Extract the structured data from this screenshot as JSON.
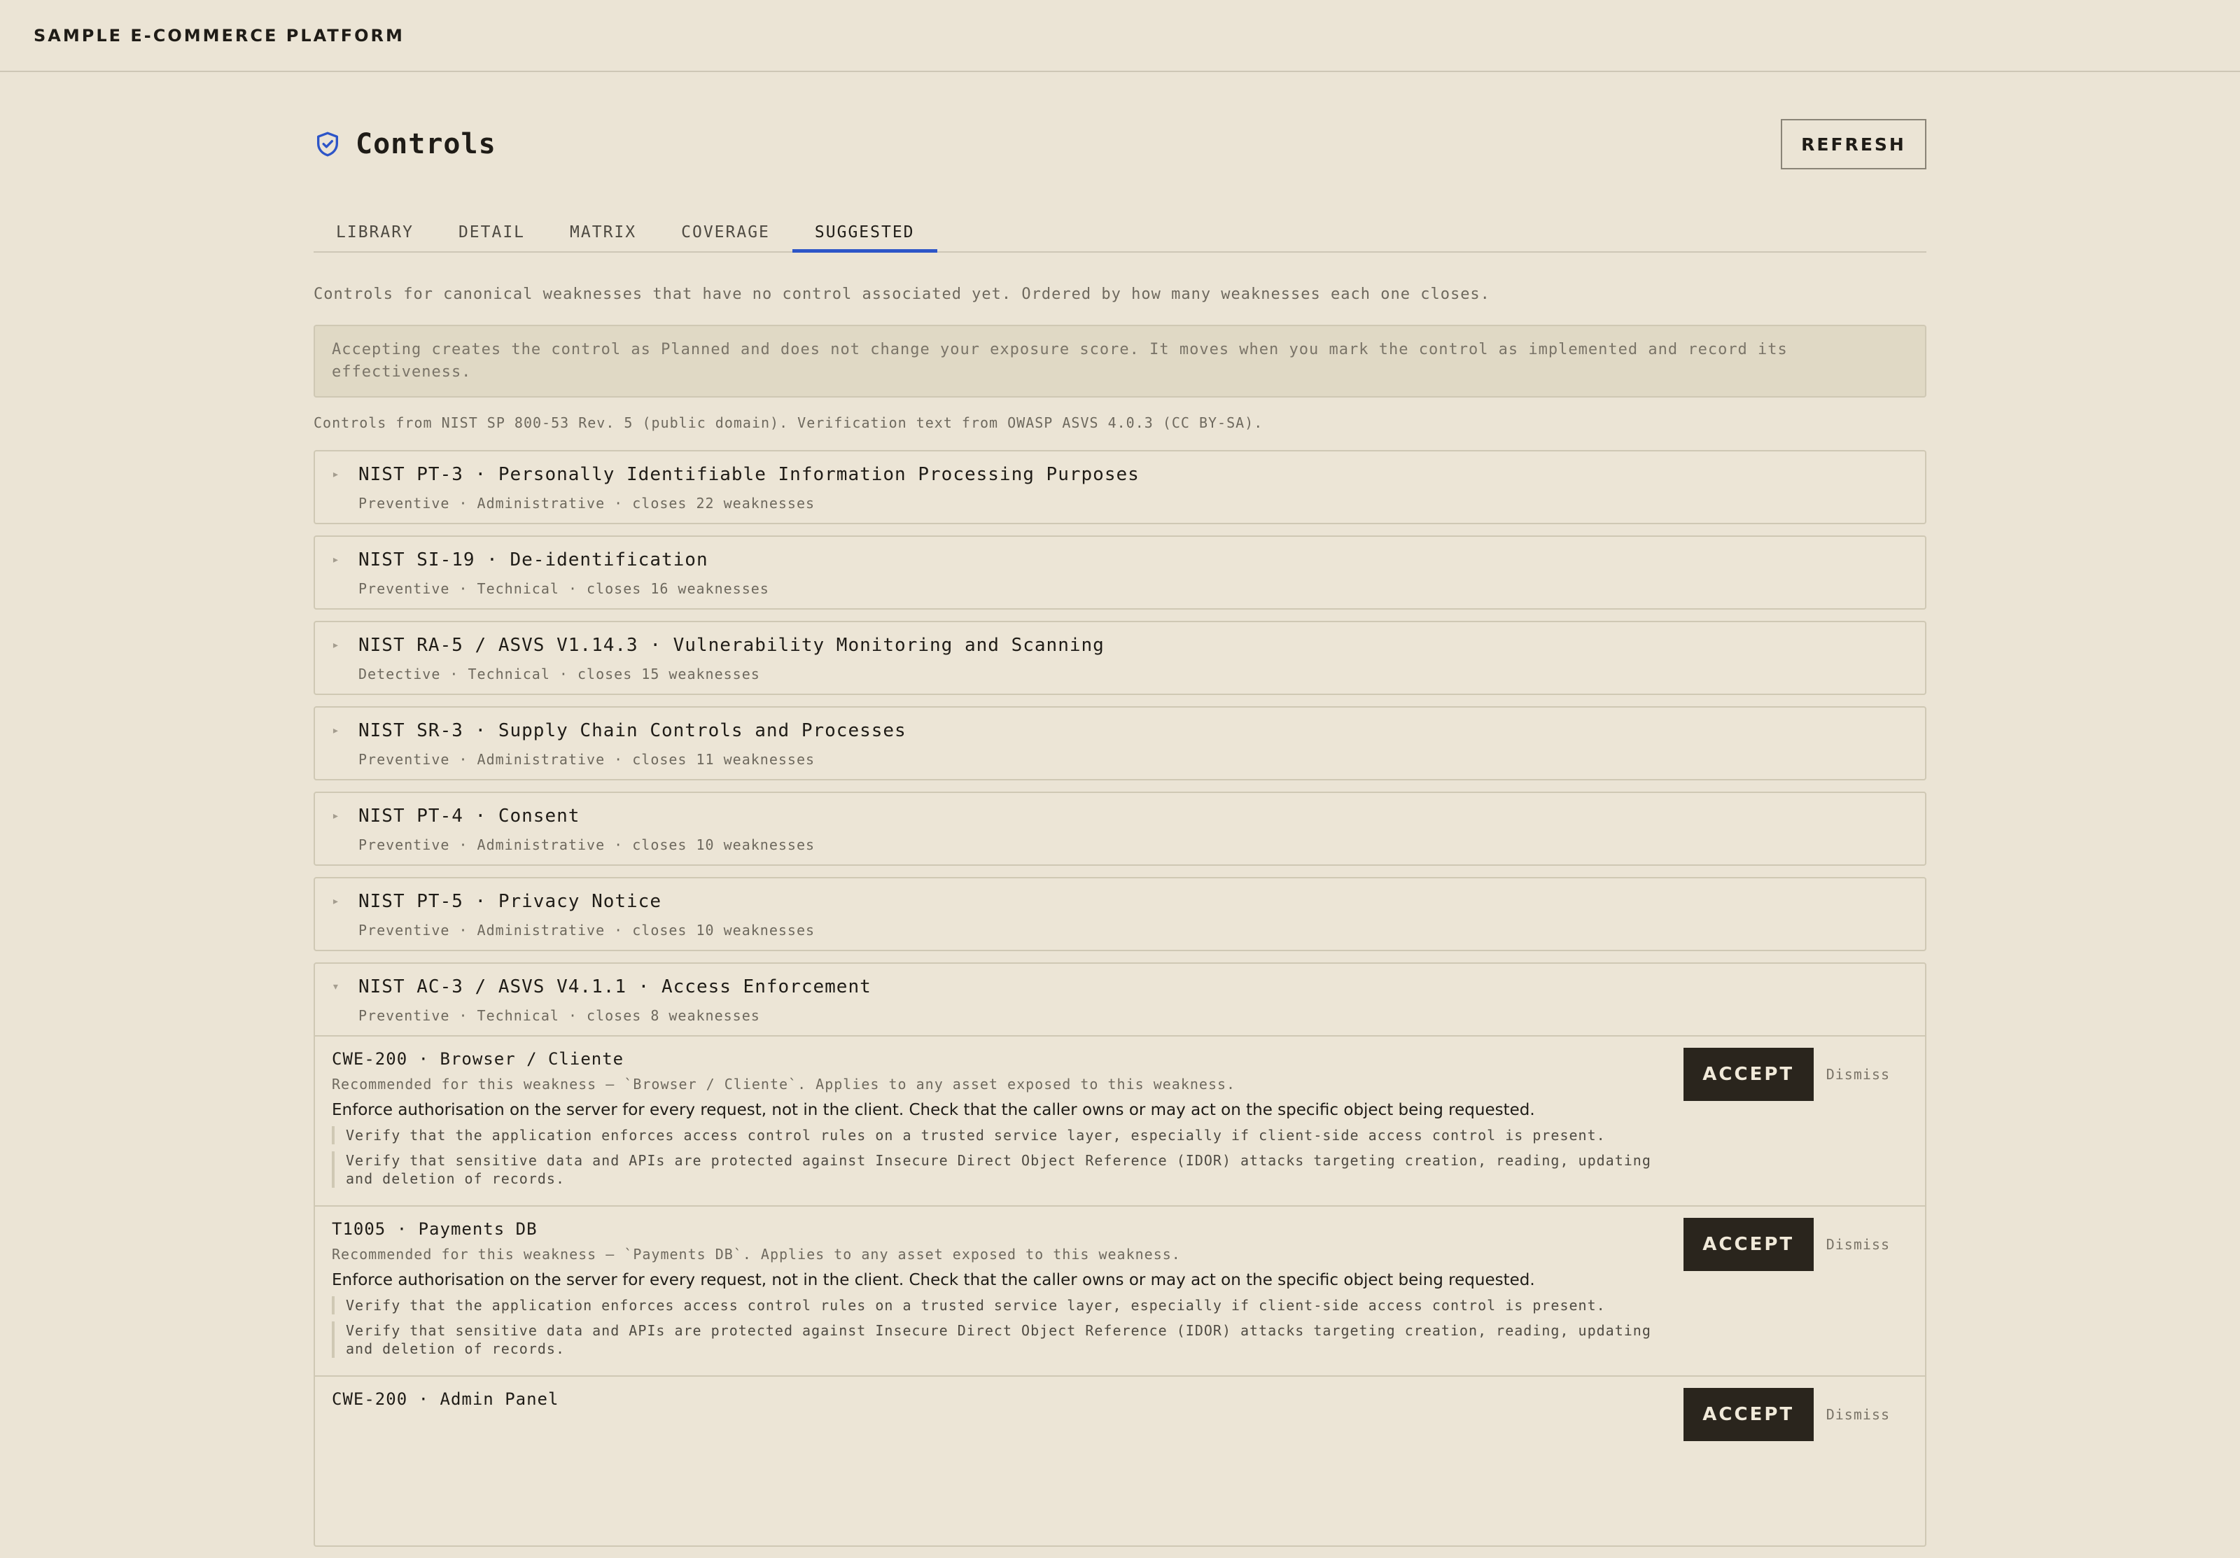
{
  "app": {
    "brand": "SAMPLE E-COMMERCE PLATFORM"
  },
  "header": {
    "title": "Controls",
    "refresh_label": "REFRESH",
    "icon": "shield-check-icon"
  },
  "tabs": [
    {
      "label": "LIBRARY"
    },
    {
      "label": "DETAIL"
    },
    {
      "label": "MATRIX"
    },
    {
      "label": "COVERAGE"
    },
    {
      "label": "SUGGESTED",
      "active": true
    }
  ],
  "intro": "Controls for canonical weaknesses that have no control associated yet. Ordered by how many weaknesses each one closes.",
  "notice": "Accepting creates the control as Planned and does not change your exposure score. It moves when you mark the control as implemented and record its effectiveness.",
  "attribution": "Controls from NIST SP 800-53 Rev. 5 (public domain). Verification text from OWASP ASVS 4.0.3 (CC BY-SA).",
  "controls": [
    {
      "title": "NIST PT-3 · Personally Identifiable Information Processing Purposes",
      "meta": "Preventive · Administrative · closes 22 weaknesses"
    },
    {
      "title": "NIST SI-19 · De-identification",
      "meta": "Preventive · Technical · closes 16 weaknesses"
    },
    {
      "title": "NIST RA-5 / ASVS V1.14.3 · Vulnerability Monitoring and Scanning",
      "meta": "Detective · Technical · closes 15 weaknesses"
    },
    {
      "title": "NIST SR-3 · Supply Chain Controls and Processes",
      "meta": "Preventive · Administrative · closes 11 weaknesses"
    },
    {
      "title": "NIST PT-4 · Consent",
      "meta": "Preventive · Administrative · closes 10 weaknesses"
    },
    {
      "title": "NIST PT-5 · Privacy Notice",
      "meta": "Preventive · Administrative · closes 10 weaknesses"
    },
    {
      "title": "NIST AC-3 / ASVS V4.1.1 · Access Enforcement",
      "meta": "Preventive · Technical · closes 8 weaknesses",
      "expanded": true,
      "recommendations": [
        {
          "title": "CWE-200 · Browser / Cliente",
          "note": "Recommended for this weakness — `Browser / Cliente`. Applies to any asset exposed to this weakness.",
          "description": "Enforce authorisation on the server for every request, not in the client. Check that the caller owns or may act on the specific object being requested.",
          "verifications": [
            "Verify that the application enforces access control rules on a trusted service layer, especially if client-side access control is present.",
            "Verify that sensitive data and APIs are protected against Insecure Direct Object Reference (IDOR) attacks targeting creation, reading, updating and deletion of records."
          ],
          "accept_label": "ACCEPT",
          "dismiss_label": "Dismiss"
        },
        {
          "title": "T1005 · Payments DB",
          "note": "Recommended for this weakness — `Payments DB`. Applies to any asset exposed to this weakness.",
          "description": "Enforce authorisation on the server for every request, not in the client. Check that the caller owns or may act on the specific object being requested.",
          "verifications": [
            "Verify that the application enforces access control rules on a trusted service layer, especially if client-side access control is present.",
            "Verify that sensitive data and APIs are protected against Insecure Direct Object Reference (IDOR) attacks targeting creation, reading, updating and deletion of records."
          ],
          "accept_label": "ACCEPT",
          "dismiss_label": "Dismiss"
        },
        {
          "title": "CWE-200 · Admin Panel",
          "note": "",
          "description": "",
          "verifications": [],
          "accept_label": "ACCEPT",
          "dismiss_label": "Dismiss"
        }
      ]
    }
  ],
  "colors": {
    "background": "#ebe4d5",
    "accent": "#2d55c8",
    "button_dark": "#2a251d"
  }
}
